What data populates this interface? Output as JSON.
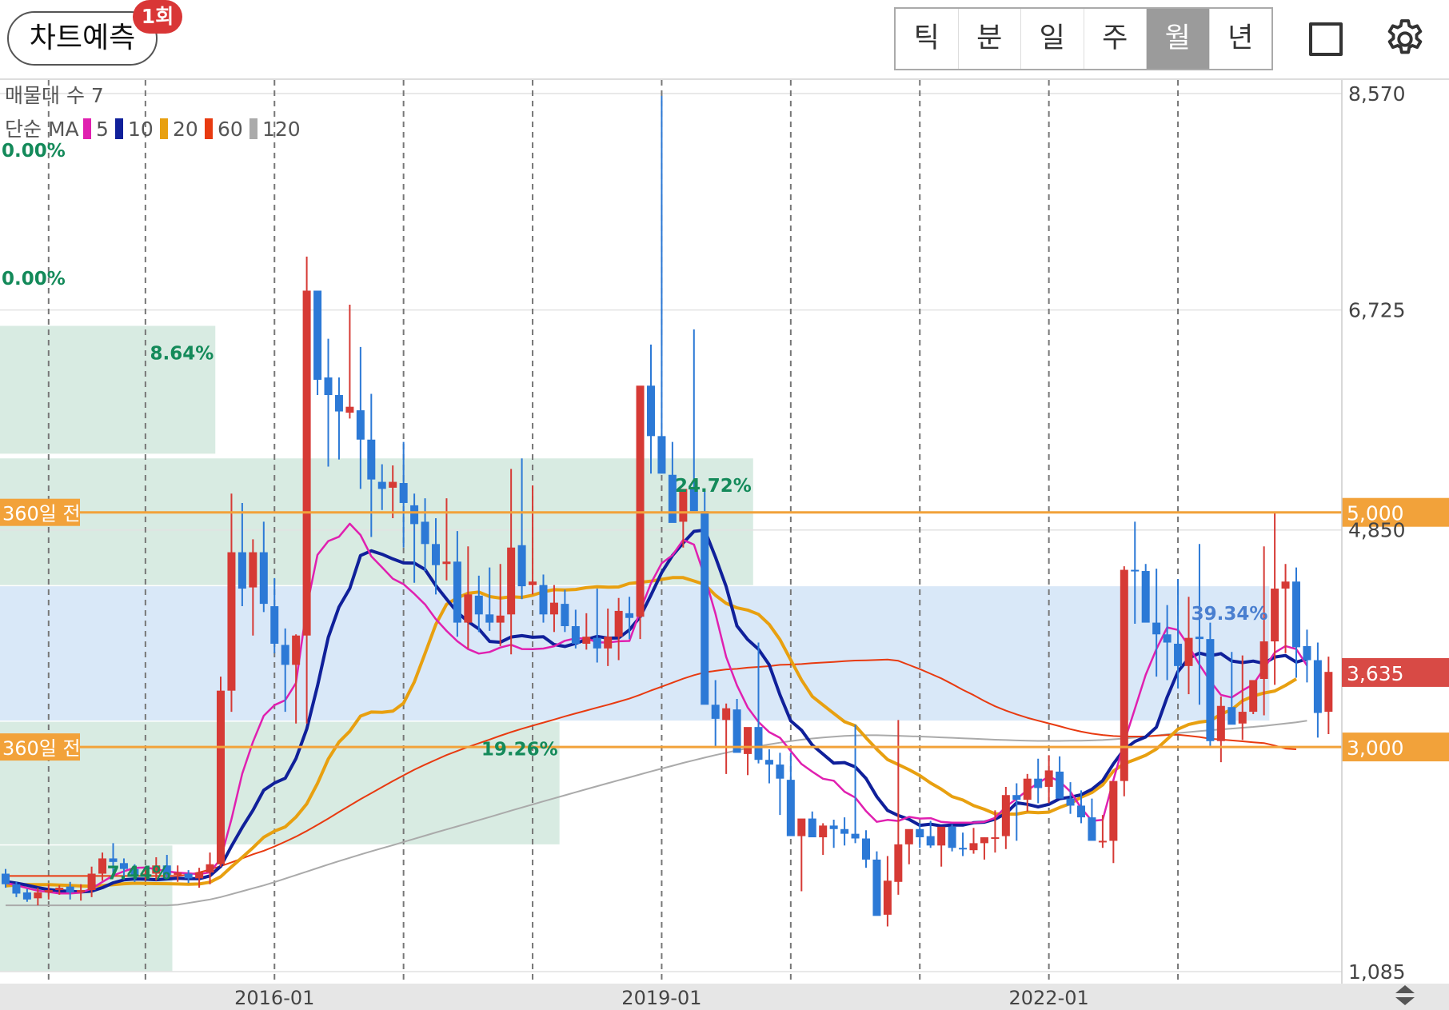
{
  "header": {
    "predict_label": "차트예측",
    "predict_badge": "1회",
    "tabs": [
      {
        "label": "틱",
        "active": false
      },
      {
        "label": "분",
        "active": false
      },
      {
        "label": "일",
        "active": false
      },
      {
        "label": "주",
        "active": false
      },
      {
        "label": "월",
        "active": true
      },
      {
        "label": "년",
        "active": false
      }
    ],
    "icons": [
      "square-icon",
      "gear-icon"
    ]
  },
  "colors": {
    "up": "#d63a35",
    "down": "#2c79d6",
    "ma5": "#e020b0",
    "ma10": "#10209a",
    "ma20": "#e8a010",
    "ma60": "#e83a10",
    "ma120": "#aaaaaa",
    "ref_line": "#f2a23a",
    "last_price_bg": "#d84a45",
    "zone_green": "#d8ebe2",
    "zone_blue": "#d9e8f8",
    "pct_text": "#148a5a"
  },
  "chart_data": {
    "type": "candlestick",
    "interval": "monthly",
    "title": "",
    "indicator_label": "매물대 수 7",
    "ma_legend": {
      "prefix": "단순 MA",
      "periods": [
        "5",
        "10",
        "20",
        "60",
        "120"
      ]
    },
    "ylim": [
      1085,
      8570
    ],
    "y_ticks": [
      "8,570",
      "6,725",
      "4,850",
      "1,085"
    ],
    "y_tick_values": [
      8570,
      6725,
      4850,
      1085
    ],
    "x_labels": [
      "2016-01",
      "2019-01",
      "2022-01"
    ],
    "x_label_index": [
      25,
      61,
      97
    ],
    "vgrid_index": [
      -1,
      4,
      13,
      25,
      37,
      49,
      61,
      73,
      85,
      97,
      109
    ],
    "reference_lines": [
      {
        "label": "360일 전",
        "price_label": "5,000",
        "value": 5000
      },
      {
        "label": "360일 전",
        "price_label": "3,000",
        "value": 3000
      }
    ],
    "last_price": {
      "label": "3,635",
      "value": 3635
    },
    "volume_profile_zones": [
      {
        "type": "green",
        "from_index": -7.5,
        "to_index": 19.5,
        "low": 5500,
        "high": 6590,
        "label": "8.64%"
      },
      {
        "type": "green",
        "from_index": -7.5,
        "to_index": 69.5,
        "low": 4380,
        "high": 5460,
        "label": "24.72%"
      },
      {
        "type": "blue",
        "from_index": -7.5,
        "to_index": 117.5,
        "low": 3225,
        "high": 4370,
        "label": "39.34%"
      },
      {
        "type": "green",
        "from_index": -7.5,
        "to_index": 51.5,
        "low": 2170,
        "high": 3215,
        "label": "19.26%"
      },
      {
        "type": "green",
        "from_index": -7.5,
        "to_index": 15.5,
        "low": 1085,
        "high": 2160,
        "label": "7.44%"
      }
    ],
    "pct_labels_top": [
      "0.00%",
      "0.00%"
    ],
    "ohlc": [
      [
        1920,
        1960,
        1800,
        1830
      ],
      [
        1830,
        1850,
        1720,
        1750
      ],
      [
        1760,
        1790,
        1680,
        1700
      ],
      [
        1710,
        1800,
        1650,
        1760
      ],
      [
        1760,
        1830,
        1700,
        1780
      ],
      [
        1780,
        1820,
        1740,
        1800
      ],
      [
        1810,
        1850,
        1700,
        1760
      ],
      [
        1760,
        1830,
        1690,
        1780
      ],
      [
        1780,
        1980,
        1720,
        1920
      ],
      [
        1920,
        2100,
        1860,
        2050
      ],
      [
        2050,
        2180,
        1900,
        2020
      ],
      [
        2010,
        2050,
        1870,
        1960
      ],
      [
        1960,
        2000,
        1850,
        1900
      ],
      [
        1900,
        1980,
        1860,
        1920
      ],
      [
        1920,
        2060,
        1860,
        1990
      ],
      [
        1990,
        2080,
        1880,
        1910
      ],
      [
        1910,
        1990,
        1850,
        1930
      ],
      [
        1920,
        1950,
        1840,
        1880
      ],
      [
        1880,
        1970,
        1800,
        1930
      ],
      [
        1930,
        2100,
        1830,
        2000
      ],
      [
        2000,
        3600,
        1980,
        3480
      ],
      [
        3480,
        5160,
        3300,
        4660
      ],
      [
        4660,
        5080,
        4200,
        4350
      ],
      [
        4360,
        4770,
        3950,
        4660
      ],
      [
        4660,
        4920,
        4150,
        4220
      ],
      [
        4200,
        4440,
        3800,
        3880
      ],
      [
        3870,
        4010,
        3300,
        3700
      ],
      [
        3700,
        3960,
        3200,
        3950
      ],
      [
        3950,
        7180,
        3200,
        6890
      ],
      [
        6890,
        6240,
        6000,
        6130
      ],
      [
        6150,
        6480,
        5390,
        6000
      ],
      [
        6000,
        6150,
        5450,
        5860
      ],
      [
        5850,
        6770,
        5800,
        5900
      ],
      [
        5870,
        6410,
        5200,
        5620
      ],
      [
        5620,
        6010,
        4790,
        5280
      ],
      [
        5260,
        5410,
        5020,
        5200
      ],
      [
        5210,
        5400,
        4950,
        5260
      ],
      [
        5250,
        5600,
        4700,
        5080
      ],
      [
        5060,
        5160,
        4400,
        4900
      ],
      [
        4920,
        5120,
        4500,
        4730
      ],
      [
        4730,
        4950,
        4300,
        4550
      ],
      [
        4560,
        5120,
        4420,
        4580
      ],
      [
        4580,
        4840,
        3940,
        4060
      ],
      [
        4060,
        4710,
        3840,
        4300
      ],
      [
        4290,
        4460,
        3980,
        4130
      ],
      [
        4130,
        4530,
        3990,
        4060
      ],
      [
        4060,
        4560,
        3860,
        4120
      ],
      [
        4130,
        5370,
        3790,
        4700
      ],
      [
        4720,
        5460,
        4260,
        4370
      ],
      [
        4380,
        5230,
        4300,
        4410
      ],
      [
        4380,
        4470,
        4060,
        4130
      ],
      [
        4130,
        4380,
        3980,
        4230
      ],
      [
        4220,
        4340,
        3980,
        4030
      ],
      [
        4030,
        4170,
        3840,
        3880
      ],
      [
        3880,
        4140,
        3830,
        3940
      ],
      [
        3930,
        4350,
        3720,
        3840
      ],
      [
        3840,
        4180,
        3690,
        3940
      ],
      [
        3940,
        4270,
        3740,
        4160
      ],
      [
        4140,
        4280,
        3920,
        4100
      ],
      [
        4110,
        4870,
        3920,
        6080
      ],
      [
        6080,
        6430,
        5330,
        5650
      ],
      [
        5650,
        8550,
        5530,
        5330
      ],
      [
        5320,
        5600,
        4950,
        4910
      ],
      [
        4920,
        5000,
        4700,
        5200
      ],
      [
        5210,
        6560,
        5050,
        5010
      ],
      [
        5010,
        5180,
        4900,
        3360
      ],
      [
        3360,
        3570,
        3000,
        3240
      ],
      [
        3230,
        3370,
        2770,
        3330
      ],
      [
        3320,
        3410,
        2960,
        2950
      ],
      [
        2940,
        3140,
        2760,
        3170
      ],
      [
        3170,
        3890,
        2860,
        2890
      ],
      [
        2890,
        2980,
        2690,
        2850
      ],
      [
        2850,
        2950,
        2420,
        2730
      ],
      [
        2720,
        2950,
        2390,
        2240
      ],
      [
        2240,
        2300,
        1770,
        2390
      ],
      [
        2390,
        2450,
        2260,
        2230
      ],
      [
        2230,
        2350,
        2080,
        2330
      ],
      [
        2330,
        2380,
        2140,
        2300
      ],
      [
        2300,
        2400,
        2160,
        2260
      ],
      [
        2260,
        3190,
        2180,
        2220
      ],
      [
        2220,
        2290,
        1970,
        2040
      ],
      [
        2040,
        2110,
        1610,
        1560
      ],
      [
        1570,
        2070,
        1470,
        1860
      ],
      [
        1850,
        3230,
        1740,
        2170
      ],
      [
        2170,
        2290,
        2000,
        2300
      ],
      [
        2300,
        2350,
        2140,
        2230
      ],
      [
        2240,
        2370,
        2140,
        2160
      ],
      [
        2160,
        2300,
        1980,
        2320
      ],
      [
        2320,
        2340,
        2110,
        2140
      ],
      [
        2140,
        2270,
        2070,
        2130
      ],
      [
        2120,
        2310,
        2090,
        2180
      ],
      [
        2180,
        2230,
        2040,
        2230
      ],
      [
        2230,
        2460,
        2100,
        2230
      ],
      [
        2240,
        2660,
        2130,
        2590
      ],
      [
        2590,
        2690,
        2200,
        2550
      ],
      [
        2550,
        2770,
        2450,
        2730
      ],
      [
        2730,
        2900,
        2520,
        2650
      ],
      [
        2660,
        2930,
        2520,
        2800
      ],
      [
        2790,
        2920,
        2560,
        2560
      ],
      [
        2560,
        2700,
        2430,
        2500
      ],
      [
        2500,
        2630,
        2350,
        2400
      ],
      [
        2400,
        2560,
        2300,
        2200
      ],
      [
        2200,
        2420,
        2140,
        2200
      ],
      [
        2200,
        2450,
        2010,
        2710
      ],
      [
        2710,
        4540,
        2580,
        4510
      ],
      [
        4510,
        4920,
        4050,
        4500
      ],
      [
        4500,
        4560,
        4140,
        4060
      ],
      [
        4060,
        4520,
        3600,
        3960
      ],
      [
        3960,
        4210,
        3570,
        3890
      ],
      [
        3880,
        4430,
        3500,
        3690
      ],
      [
        3690,
        4280,
        3450,
        3930
      ],
      [
        3940,
        4730,
        3360,
        3920
      ],
      [
        3920,
        4060,
        3010,
        3050
      ],
      [
        3050,
        3430,
        2870,
        3350
      ],
      [
        3340,
        3810,
        3250,
        3190
      ],
      [
        3200,
        3780,
        3060,
        3300
      ],
      [
        3300,
        3560,
        3280,
        3570
      ],
      [
        3580,
        4710,
        3270,
        3900
      ],
      [
        3900,
        5000,
        3530,
        4350
      ],
      [
        4350,
        4560,
        3800,
        4410
      ],
      [
        4410,
        4530,
        3590,
        3850
      ],
      [
        3860,
        4000,
        3550,
        3740
      ],
      [
        3740,
        3890,
        3080,
        3290
      ],
      [
        3300,
        3770,
        3110,
        3640
      ]
    ],
    "ma5": [
      1842,
      1821,
      1797,
      1774,
      1764,
      1752,
      1752,
      1758,
      1792,
      1850,
      1904,
      1940,
      1970,
      1972,
      1958,
      1939,
      1928,
      1923,
      1916,
      1931,
      2047,
      2383,
      2772,
      3043,
      3266,
      3357,
      3399,
      3545,
      4191,
      4637,
      4755,
      4792,
      4903,
      4807,
      4626,
      4531,
      4435,
      4388,
      4305,
      4215,
      4090,
      3990,
      3901,
      3834,
      3796,
      3810,
      3848,
      3871,
      3835,
      3834,
      3839,
      3859,
      3905,
      3926,
      3925,
      3892,
      3890,
      3901,
      3904,
      4159,
      4395,
      4566,
      4634,
      4765,
      4725,
      4451,
      4136,
      3767,
      3525,
      3337,
      3213,
      3127,
      3078,
      2966,
      2855,
      2789,
      2729,
      2712,
      2619,
      2569,
      2453,
      2362,
      2378,
      2369,
      2404,
      2390,
      2393,
      2361,
      2354,
      2354,
      2356,
      2362,
      2396,
      2490,
      2558,
      2631,
      2692,
      2748,
      2707,
      2620,
      2480,
      2370,
      2378,
      2717,
      3041,
      3328,
      3615,
      3834,
      4019,
      3998,
      3861,
      3702,
      3563,
      3444,
      3422,
      3482,
      3533,
      3670,
      3804,
      3860,
      3834,
      3694
    ],
    "ma10": [
      1853,
      1839,
      1822,
      1801,
      1785,
      1774,
      1769,
      1764,
      1771,
      1801,
      1842,
      1867,
      1875,
      1873,
      1868,
      1875,
      1881,
      1877,
      1877,
      1901,
      1982,
      2154,
      2314,
      2460,
      2631,
      2693,
      2733,
      2901,
      3153,
      3519,
      3934,
      4193,
      4351,
      4632,
      4672,
      4643,
      4603,
      4569,
      4568,
      4513,
      4376,
      4261,
      4148,
      4069,
      4006,
      3900,
      3893,
      3937,
      3949,
      3935,
      3939,
      3873,
      3857,
      3883,
      3916,
      3943,
      3928,
      3929,
      3998,
      4110,
      4294,
      4486,
      4632,
      4739,
      4838,
      4849,
      4618,
      4367,
      4031,
      3916,
      3833,
      3701,
      3444,
      3223,
      3143,
      3016,
      2939,
      2862,
      2867,
      2830,
      2731,
      2576,
      2459,
      2416,
      2383,
      2332,
      2342,
      2327,
      2335,
      2334,
      2354,
      2359,
      2385,
      2432,
      2524,
      2511,
      2489,
      2511,
      2559,
      2572,
      2593,
      2639,
      2713,
      2856,
      2979,
      3047,
      3086,
      3169,
      3426,
      3642,
      3756,
      3800,
      3778,
      3796,
      3733,
      3720,
      3732,
      3712,
      3767,
      3780,
      3723,
      3750
    ],
    "ma20": [
      1816,
      1823,
      1826,
      1826,
      1826,
      1823,
      1819,
      1815,
      1813,
      1818,
      1826,
      1834,
      1838,
      1837,
      1835,
      1834,
      1832,
      1830,
      1832,
      1847,
      1894,
      1978,
      2059,
      2141,
      2230,
      2283,
      2319,
      2403,
      2515,
      2689,
      2897,
      3042,
      3134,
      3263,
      3298,
      3296,
      3305,
      3373,
      3554,
      3797,
      4045,
      4216,
      4271,
      4310,
      4321,
      4282,
      4269,
      4280,
      4275,
      4293,
      4323,
      4341,
      4338,
      4343,
      4358,
      4365,
      4362,
      4364,
      4394,
      4403,
      4414,
      4429,
      4444,
      4444,
      4415,
      4385,
      4293,
      4224,
      4186,
      4167,
      4131,
      4045,
      3915,
      3742,
      3571,
      3431,
      3358,
      3286,
      3215,
      3181,
      3078,
      2980,
      2893,
      2850,
      2806,
      2756,
      2693,
      2640,
      2577,
      2548,
      2500,
      2469,
      2431,
      2428,
      2428,
      2445,
      2440,
      2444,
      2484,
      2517,
      2572,
      2611,
      2677,
      2794,
      2858,
      2892,
      2929,
      2982,
      3066,
      3152,
      3192,
      3212,
      3223,
      3280,
      3318,
      3394,
      3434,
      3460,
      3477,
      3525,
      3580
    ],
    "ma60": [
      1900,
      1900,
      1900,
      1900,
      1900,
      1900,
      1900,
      1900,
      1900,
      1900,
      1900,
      1900,
      1900,
      1900,
      1900,
      1900,
      1902,
      1912,
      1930,
      1955,
      1984,
      2016,
      2050,
      2085,
      2115,
      2152,
      2193,
      2236,
      2284,
      2336,
      2390,
      2446,
      2500,
      2555,
      2606,
      2658,
      2709,
      2758,
      2806,
      2849,
      2891,
      2931,
      2966,
      3000,
      3032,
      3063,
      3096,
      3127,
      3155,
      3182,
      3208,
      3234,
      3261,
      3286,
      3311,
      3336,
      3360,
      3386,
      3412,
      3445,
      3481,
      3514,
      3548,
      3582,
      3612,
      3636,
      3649,
      3661,
      3666,
      3676,
      3682,
      3689,
      3700,
      3703,
      3707,
      3714,
      3720,
      3725,
      3732,
      3737,
      3739,
      3742,
      3745,
      3735,
      3699,
      3664,
      3624,
      3585,
      3537,
      3487,
      3442,
      3392,
      3347,
      3310,
      3278,
      3249,
      3224,
      3201,
      3177,
      3152,
      3131,
      3114,
      3102,
      3093,
      3090,
      3089,
      3090,
      3096,
      3102,
      3104,
      3095,
      3085,
      3070,
      3063,
      3056,
      3048,
      3040,
      3033,
      3012,
      2986,
      2980
    ],
    "ma120": [
      1650,
      1650,
      1650,
      1650,
      1650,
      1650,
      1650,
      1650,
      1650,
      1650,
      1650,
      1650,
      1650,
      1650,
      1650,
      1650,
      1655,
      1670,
      1685,
      1700,
      1720,
      1745,
      1770,
      1795,
      1820,
      1848,
      1878,
      1908,
      1938,
      1968,
      1998,
      2027,
      2055,
      2083,
      2110,
      2137,
      2163,
      2190,
      2217,
      2244,
      2271,
      2297,
      2323,
      2350,
      2376,
      2403,
      2430,
      2457,
      2484,
      2510,
      2536,
      2562,
      2588,
      2614,
      2640,
      2666,
      2691,
      2716,
      2741,
      2766,
      2791,
      2816,
      2840,
      2864,
      2887,
      2909,
      2931,
      2951,
      2971,
      2989,
      3006,
      3022,
      3037,
      3050,
      3062,
      3072,
      3081,
      3088,
      3094,
      3098,
      3100,
      3100,
      3098,
      3095,
      3092,
      3089,
      3086,
      3082,
      3078,
      3074,
      3070,
      3066,
      3062,
      3059,
      3056,
      3054,
      3052,
      3052,
      3052,
      3053,
      3054,
      3056,
      3059,
      3065,
      3072,
      3080,
      3089,
      3098,
      3108,
      3118,
      3127,
      3135,
      3143,
      3150,
      3157,
      3164,
      3171,
      3180,
      3190,
      3200,
      3210,
      3224
    ]
  }
}
